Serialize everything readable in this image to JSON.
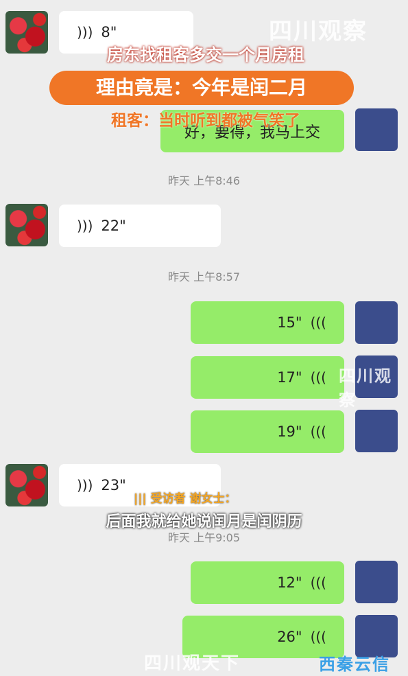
{
  "messages": [
    {
      "side": "left",
      "duration": "8\""
    },
    {
      "side": "right",
      "text": "好，要得，我马上交"
    },
    {
      "side": "left",
      "duration": "22\""
    },
    {
      "side": "right",
      "duration": "15\""
    },
    {
      "side": "right",
      "duration": "17\""
    },
    {
      "side": "right",
      "duration": "19\""
    },
    {
      "side": "left",
      "duration": "23\""
    },
    {
      "side": "right",
      "duration": "12\""
    },
    {
      "side": "right",
      "duration": "26\""
    }
  ],
  "timestamps": [
    "昨天 上午8:46",
    "昨天 上午8:57",
    "昨天 上午9:05"
  ],
  "captions": {
    "line1": "房东找租客多交一个月房租",
    "line2": "理由竟是：今年是闰二月",
    "line3": "租客：当时听到都被气笑了"
  },
  "interview": {
    "label": "受访者 谢女士：",
    "subtitle": "后面我就给她说闰月是闰阴历"
  },
  "watermarks": {
    "top": "四川观察",
    "middle": "四川观察",
    "bottom_left": "四川观天下",
    "bottom_right": "西秦云信"
  },
  "icons": {
    "wave_left": "voice-wave-icon",
    "wave_right": "voice-wave-icon"
  },
  "colors": {
    "bubble_right": "#95ec69",
    "bubble_left": "#ffffff",
    "caption_orange": "#f07626",
    "background": "#ededed"
  }
}
